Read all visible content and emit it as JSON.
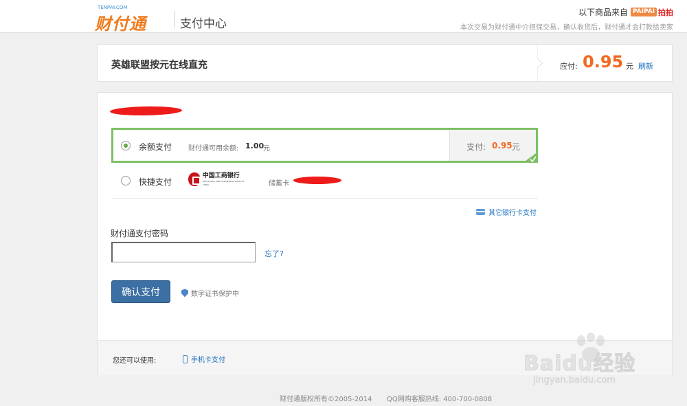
{
  "header": {
    "logo_small": "TENPAY.COM",
    "logo_main": "财付通",
    "center_title": "支付中心",
    "source_label": "以下商品来自",
    "source_brand_box": "PAIPAI",
    "source_brand_text": "拍拍",
    "notice": "本次交易为财付通中介担保交易，确认收货后，财付通才会打款给卖家"
  },
  "order": {
    "title": "英雄联盟按元在线直充",
    "due_label": "应付:",
    "due_amount": "0.95",
    "due_unit": "元",
    "refresh": "刷新"
  },
  "payment": {
    "balance_option": {
      "label": "余额支付",
      "balance_label": "财付通可用余额:",
      "balance_amount": "1.00",
      "balance_unit": "元",
      "pay_label": "支付:",
      "pay_amount": "0.95",
      "pay_unit": "元",
      "selected": true
    },
    "quick_option": {
      "label": "快捷支付",
      "bank_name": "中国工商银行",
      "bank_name_en": "INDUSTRIAL AND COMMERCIAL BANK OF CHINA",
      "card_type": "储蓄卡",
      "selected": false
    },
    "other_bank": "其它银行卡支付",
    "password_label": "财付通支付密码",
    "password_value": "",
    "forgot": "忘了?",
    "confirm_button": "确认支付",
    "cert_text": "数字证书保护中",
    "also_label": "您还可以使用:",
    "mobile_pay": "手机卡支付"
  },
  "footer": {
    "copyright": "财付通版权所有©2005-2014",
    "hotline": "QQ网购客服热线: 400-700-0808"
  },
  "watermark": {
    "brand": "Baidu经验",
    "site": "jingyan.baidu.com"
  },
  "colors": {
    "accent_orange": "#f26a21",
    "link_blue": "#1a6fbf",
    "selected_green": "#7dc065",
    "button_blue": "#3c6fa3"
  }
}
